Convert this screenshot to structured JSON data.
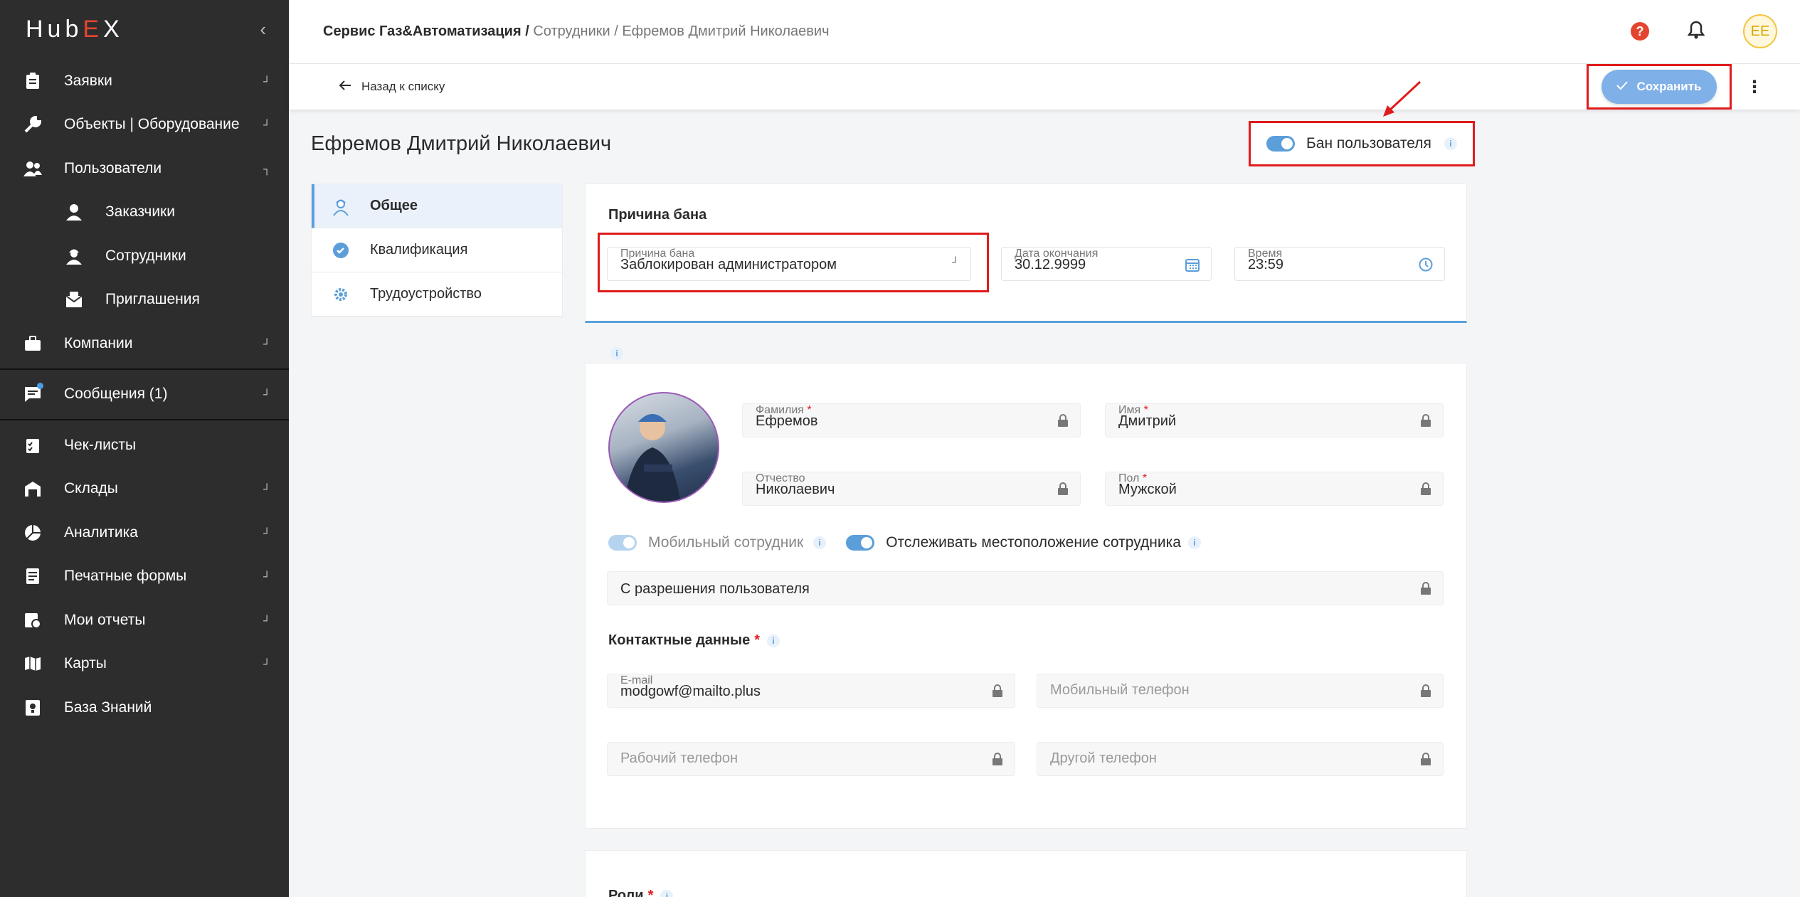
{
  "sidebar": {
    "logo": {
      "pre": "Hub",
      "x": "E",
      "post": "X"
    },
    "items": [
      {
        "label": "Заявки",
        "icon": "clipboard-icon",
        "chev": "┘"
      },
      {
        "label": "Объекты | Оборудование",
        "icon": "wrench-icon",
        "chev": "┘"
      },
      {
        "label": "Пользователи",
        "icon": "users-icon",
        "chev": "┐"
      },
      {
        "label": "Заказчики",
        "icon": "customer-icon"
      },
      {
        "label": "Сотрудники",
        "icon": "employee-icon"
      },
      {
        "label": "Приглашения",
        "icon": "envelope-icon"
      },
      {
        "label": "Компании",
        "icon": "briefcase-icon",
        "chev": "┘"
      },
      {
        "label": "Сообщения (1)",
        "icon": "chat-icon",
        "chev": "┘"
      },
      {
        "label": "Чек-листы",
        "icon": "checklist-icon"
      },
      {
        "label": "Склады",
        "icon": "warehouse-icon",
        "chev": "┘"
      },
      {
        "label": "Аналитика",
        "icon": "pie-chart-icon",
        "chev": "┘"
      },
      {
        "label": "Печатные формы",
        "icon": "form-icon",
        "chev": "┘"
      },
      {
        "label": "Мои отчеты",
        "icon": "report-icon",
        "chev": "┘"
      },
      {
        "label": "Карты",
        "icon": "map-icon",
        "chev": "┘"
      },
      {
        "label": "База Знаний",
        "icon": "knowledge-icon"
      }
    ]
  },
  "topbar": {
    "crumb_company": "Сервис Газ&Автоматизация",
    "crumb_sep1": " / ",
    "crumb_employees": "Сотрудники",
    "crumb_sep2": " / ",
    "crumb_current": "Ефремов Дмитрий Николаевич",
    "help": "?",
    "avatar": "EE"
  },
  "subbar": {
    "back": "Назад к списку",
    "save": "Сохранить",
    "more": "⋮"
  },
  "page": {
    "title": "Ефремов Дмитрий Николаевич",
    "ban_toggle": "Бан пользователя",
    "info": "i"
  },
  "tabs": [
    {
      "label": "Общее",
      "icon": "worker-icon"
    },
    {
      "label": "Квалификация",
      "icon": "check-circle-icon"
    },
    {
      "label": "Трудоустройство",
      "icon": "gear-icon"
    }
  ],
  "ban": {
    "title": "Причина бана",
    "reason_label": "Причина бана",
    "reason_value": "Заблокирован администратором",
    "date_label": "Дата окончания",
    "date_value": "30.12.9999",
    "time_label": "Время",
    "time_value": "23:59"
  },
  "profile": {
    "last_name_label": "Фамилия",
    "last_name": "Ефремов",
    "first_name_label": "Имя",
    "first_name": "Дмитрий",
    "patronymic_label": "Отчество",
    "patronymic": "Николаевич",
    "gender_label": "Пол",
    "gender": "Мужской",
    "req": "*",
    "mobile_employee": "Мобильный сотрудник",
    "track_location": "Отслеживать местоположение сотрудника",
    "location_mode": "С разрешения пользователя",
    "contacts_title": "Контактные данные",
    "email_label": "E-mail",
    "email": "modgowf@mailto.plus",
    "mobile_phone_ph": "Мобильный телефон",
    "work_phone_ph": "Рабочий телефон",
    "other_phone_ph": "Другой телефон"
  },
  "bottom": {
    "roles_title": "Роли"
  },
  "colors": {
    "accent": "#5b9ed9",
    "highlight": "#e01b1b",
    "sidebar": "#2d2d2d"
  }
}
